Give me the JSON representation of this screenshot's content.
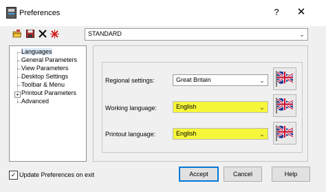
{
  "window": {
    "title": "Preferences",
    "help_glyph": "?",
    "close_glyph": "✕"
  },
  "toolbar": {
    "profile_value": "STANDARD",
    "icons": [
      "open-folder-icon",
      "save-icon",
      "delete-icon",
      "new-icon"
    ]
  },
  "tree": {
    "items": [
      {
        "label": "Languages",
        "selected": true
      },
      {
        "label": "General Parameters"
      },
      {
        "label": "View Parameters"
      },
      {
        "label": "Desktop Settings"
      },
      {
        "label": "Toolbar & Menu"
      },
      {
        "label": "Printout Parameters",
        "expandable": true
      },
      {
        "label": "Advanced"
      }
    ]
  },
  "languages": {
    "regional": {
      "label": "Regional settings:",
      "value": "Great Britain"
    },
    "working": {
      "label": "Working language:",
      "value": "English"
    },
    "printout": {
      "label": "Printout language:",
      "value": "English"
    }
  },
  "footer": {
    "update_label": "Update Preferences on exit",
    "update_checked": true,
    "accept": "Accept",
    "cancel": "Cancel",
    "help": "Help"
  },
  "colors": {
    "highlight": "#f6f63a",
    "default_button_border": "#0078d7"
  }
}
